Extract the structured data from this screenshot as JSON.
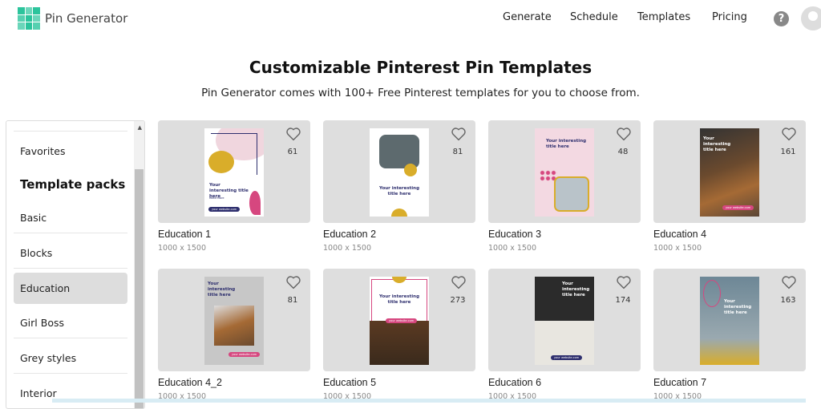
{
  "header": {
    "brand": "Pin Generator",
    "nav": [
      "Generate",
      "Schedule",
      "Templates",
      "Pricing"
    ],
    "help_icon": "?"
  },
  "hero": {
    "title": "Customizable Pinterest Pin Templates",
    "subtitle": "Pin Generator comes with 100+ Free Pinterest templates for you to choose from."
  },
  "sidebar": {
    "favorites": "Favorites",
    "section_title": "Template packs",
    "items": [
      "Basic",
      "Blocks",
      "Education",
      "Girl Boss",
      "Grey styles",
      "Interior"
    ],
    "active": "Education"
  },
  "pin_text": {
    "title": "Your interesting title here",
    "read_more": "Read More",
    "website": "your website.com"
  },
  "templates": [
    {
      "name": "Education 1",
      "size": "1000 x 1500",
      "likes": "61"
    },
    {
      "name": "Education 2",
      "size": "1000 x 1500",
      "likes": "81"
    },
    {
      "name": "Education 3",
      "size": "1000 x 1500",
      "likes": "48"
    },
    {
      "name": "Education 4",
      "size": "1000 x 1500",
      "likes": "161"
    },
    {
      "name": "Education 4_2",
      "size": "1000 x 1500",
      "likes": "81"
    },
    {
      "name": "Education 5",
      "size": "1000 x 1500",
      "likes": "273"
    },
    {
      "name": "Education 6",
      "size": "1000 x 1500",
      "likes": "174"
    },
    {
      "name": "Education 7",
      "size": "1000 x 1500",
      "likes": "163"
    }
  ],
  "colors": {
    "brand": "#2cc49c",
    "card_bg": "#dedede",
    "active_item": "#dddddd",
    "pin_pink": "#d6477f",
    "pin_navy": "#2e2f6e",
    "pin_yellow": "#d9ad2a"
  }
}
